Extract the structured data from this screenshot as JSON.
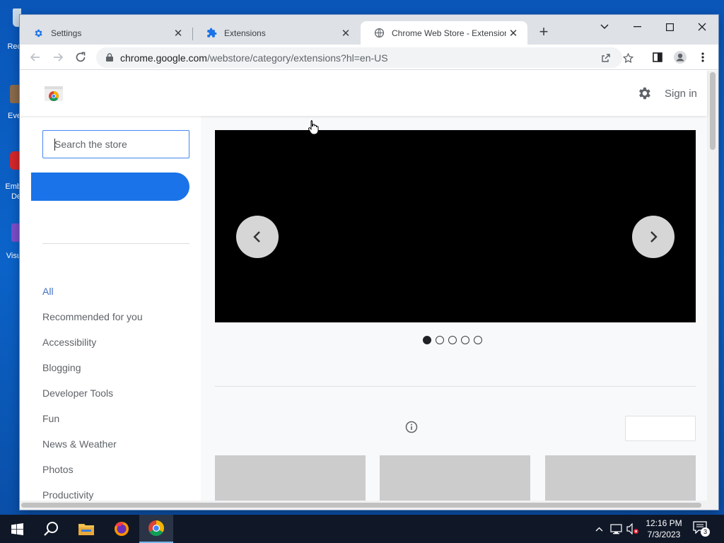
{
  "desktop": {
    "icons": [
      {
        "label": "Rec"
      },
      {
        "label": "Eve"
      },
      {
        "label": "Emb"
      },
      {
        "label": "De"
      },
      {
        "label": "Visu"
      }
    ]
  },
  "browser": {
    "tabs": [
      {
        "title": "Settings",
        "icon": "gear-icon"
      },
      {
        "title": "Extensions",
        "icon": "puzzle-icon"
      },
      {
        "title": "Chrome Web Store - Extensions",
        "icon": "globe-icon",
        "active": true
      }
    ],
    "url_host": "chrome.google.com",
    "url_path": "/webstore/category/extensions?hl=en-US"
  },
  "page": {
    "sign_in": "Sign in",
    "search_placeholder": "Search the store",
    "categories": [
      "All",
      "Recommended for you",
      "Accessibility",
      "Blogging",
      "Developer Tools",
      "Fun",
      "News & Weather",
      "Photos",
      "Productivity"
    ],
    "active_category": "All",
    "carousel": {
      "slides": 5,
      "current": 1
    },
    "colors": {
      "accent": "#1a73e8",
      "active_category": "#4270c4"
    }
  },
  "taskbar": {
    "time": "12:16 PM",
    "date": "7/3/2023",
    "notifications": "3"
  }
}
